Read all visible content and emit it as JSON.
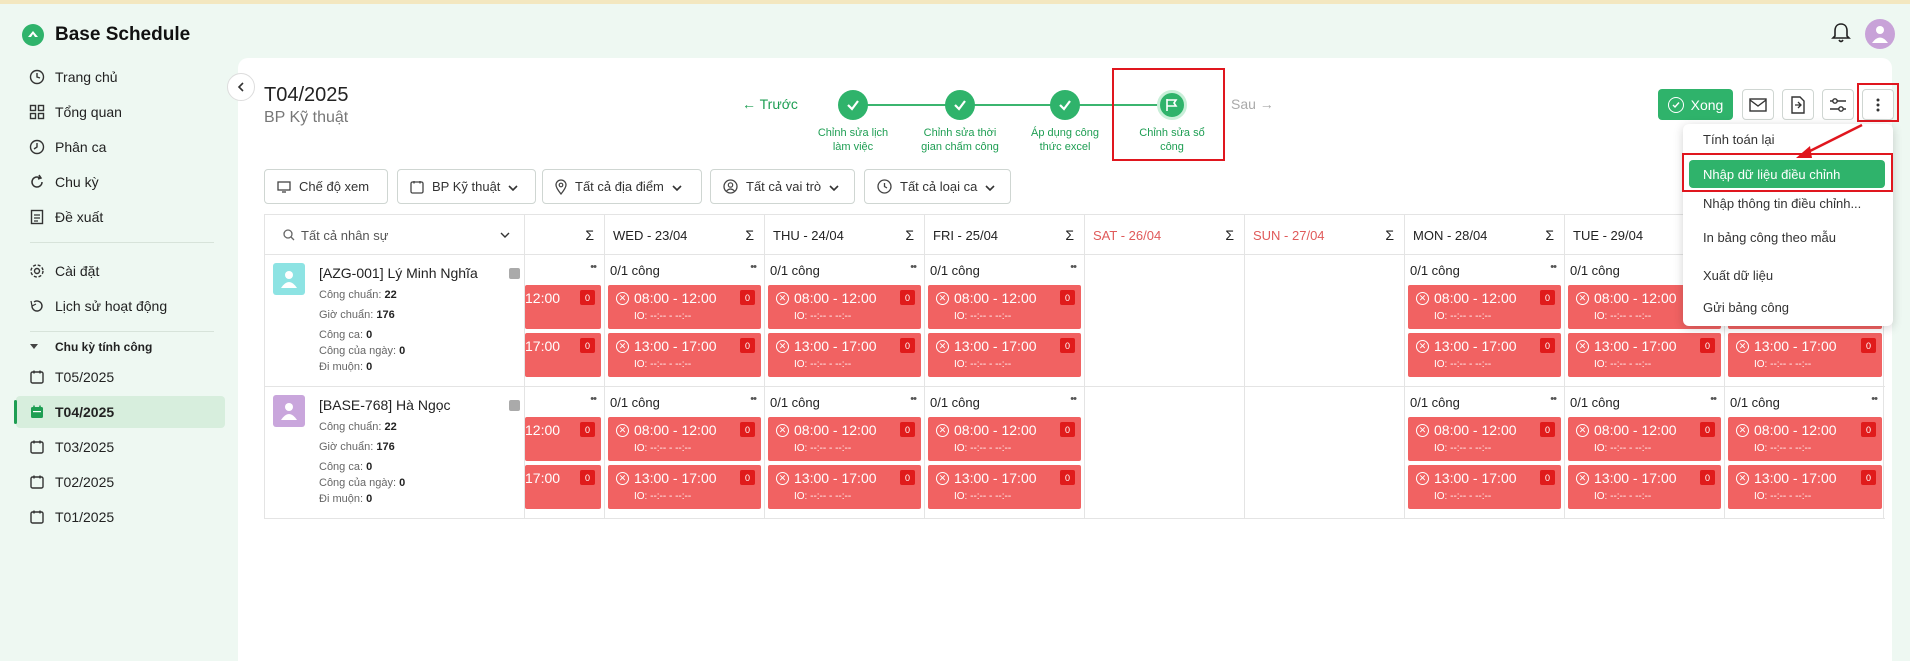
{
  "app": {
    "title": "Base Schedule"
  },
  "sidebar": {
    "items": [
      {
        "label": "Trang chủ",
        "icon": "clock-icon"
      },
      {
        "label": "Tổng quan",
        "icon": "grid-icon"
      },
      {
        "label": "Phân ca",
        "icon": "clock-icon"
      },
      {
        "label": "Chu kỳ",
        "icon": "refresh-icon"
      },
      {
        "label": "Đề xuất",
        "icon": "document-icon"
      },
      {
        "label": "Cài đặt",
        "icon": "gear-icon"
      },
      {
        "label": "Lịch sử hoạt động",
        "icon": "history-icon"
      }
    ],
    "section_label": "Chu kỳ tính công",
    "periods": [
      "T05/2025",
      "T04/2025",
      "T03/2025",
      "T02/2025",
      "T01/2025"
    ],
    "active_period": "T04/2025"
  },
  "page": {
    "title": "T04/2025",
    "subtitle": "BP Kỹ thuật"
  },
  "stepper": {
    "prev": "← Trước",
    "next": "Sau →",
    "steps": [
      {
        "l1": "Chỉnh sửa lịch",
        "l2": "làm việc"
      },
      {
        "l1": "Chỉnh sửa thời",
        "l2": "gian chấm công"
      },
      {
        "l1": "Áp dụng công",
        "l2": "thức excel"
      },
      {
        "l1": "Chỉnh sửa sổ",
        "l2": "công"
      }
    ]
  },
  "toolbar": {
    "done_label": "Xong"
  },
  "filters": {
    "view": "Chế độ xem",
    "department": "BP Kỹ thuật",
    "location": "Tất cả địa điểm",
    "role": "Tất cả vai trò",
    "shift_type": "Tất cả loại ca"
  },
  "table": {
    "search_placeholder": "Tất cả nhân sự",
    "sigma": "Σ",
    "days": [
      "WED - 23/04",
      "THU - 24/04",
      "FRI - 25/04",
      "SAT - 26/04",
      "SUN - 27/04",
      "MON - 28/04",
      "TUE - 29/04"
    ],
    "weekend_color": "#e05a5a",
    "employees": [
      {
        "name": "[AZG-001] Lý Minh Nghĩa",
        "std_work_label": "Công chuẩn:",
        "std_work": "22",
        "std_hours_label": "Giờ chuẩn:",
        "std_hours": "176",
        "shift_work_label": "Công ca:",
        "shift_work": "0",
        "day_work_label": "Công của ngày:",
        "day_work": "0",
        "late_label": "Đi muộn:",
        "late": "0",
        "avatar_color": "#8de3e3"
      },
      {
        "name": "[BASE-768] Hà Ngọc",
        "std_work_label": "Công chuẩn:",
        "std_work": "22",
        "std_hours_label": "Giờ chuẩn:",
        "std_hours": "176",
        "shift_work_label": "Công ca:",
        "shift_work": "0",
        "day_work_label": "Công của ngày:",
        "day_work": "0",
        "late_label": "Đi muộn:",
        "late": "0",
        "avatar_color": "#c9a6dc"
      }
    ],
    "cell_status": "0/1 công",
    "shift1": "08:00 - 12:00",
    "shift2": "13:00 - 17:00",
    "partial1": "12:00",
    "partial2": "17:00",
    "io": "IO: --:-- - --:--",
    "badge": "0",
    "shift_color": "#f16262"
  },
  "menu": {
    "items": [
      "Tính toán lại",
      "Nhập dữ liệu điều chỉnh",
      "Nhập thông tin điều chỉnh...",
      "In bảng công theo mẫu",
      "Xuất dữ liệu",
      "Gửi bảng công"
    ],
    "active_index": 1
  }
}
